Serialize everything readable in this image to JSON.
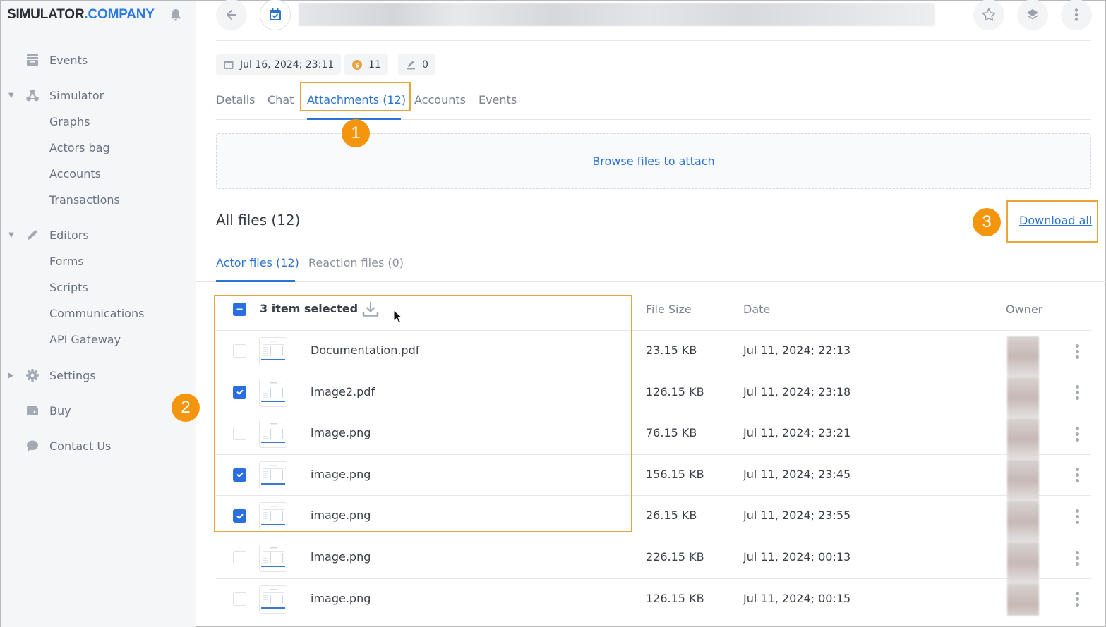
{
  "app": {
    "logo_main": "SIMULATOR",
    "logo_accent": ".COMPANY"
  },
  "sidebar": {
    "items": [
      {
        "label": "Events",
        "icon": "archive-icon"
      },
      {
        "label": "Simulator",
        "icon": "graph-nodes-icon",
        "expanded": true,
        "children": [
          "Graphs",
          "Actors bag",
          "Accounts",
          "Transactions"
        ]
      },
      {
        "label": "Editors",
        "icon": "pencil-icon",
        "expanded": true,
        "children": [
          "Forms",
          "Scripts",
          "Communications",
          "API Gateway"
        ]
      },
      {
        "label": "Settings",
        "icon": "gear-icon",
        "expanded": false
      },
      {
        "label": "Buy",
        "icon": "wallet-icon"
      },
      {
        "label": "Contact Us",
        "icon": "chat-bubble-icon"
      }
    ]
  },
  "header": {
    "title_blurred": true,
    "actions": [
      "star-icon",
      "layers-icon",
      "more-vertical-icon"
    ]
  },
  "chips": {
    "date": "Jul 16, 2024; 23:11",
    "coins": "11",
    "edits": "0"
  },
  "tabs": [
    {
      "label": "Details",
      "active": false
    },
    {
      "label": "Chat",
      "active": false
    },
    {
      "label": "Attachments (12)",
      "active": true
    },
    {
      "label": "Accounts",
      "active": false
    },
    {
      "label": "Events",
      "active": false
    }
  ],
  "dropzone": {
    "label": "Browse files to attach"
  },
  "files": {
    "title": "All files (12)",
    "download_all": "Download all",
    "subtabs": [
      {
        "label": "Actor files (12)",
        "active": true
      },
      {
        "label": "Reaction files (0)",
        "active": false
      }
    ],
    "selected_label": "3 item selected",
    "columns": {
      "size": "File Size",
      "date": "Date",
      "owner": "Owner"
    },
    "rows": [
      {
        "name": "Documentation.pdf",
        "size": "23.15 KB",
        "date": "Jul 11, 2024; 22:13",
        "checked": false
      },
      {
        "name": "image2.pdf",
        "size": "126.15 KB",
        "date": "Jul 11, 2024; 23:18",
        "checked": true
      },
      {
        "name": "image.png",
        "size": "76.15 KB",
        "date": "Jul 11, 2024; 23:21",
        "checked": false
      },
      {
        "name": "image.png",
        "size": "156.15 KB",
        "date": "Jul 11, 2024; 23:45",
        "checked": true
      },
      {
        "name": "image.png",
        "size": "26.15 KB",
        "date": "Jul 11, 2024; 23:55",
        "checked": true
      },
      {
        "name": "image.png",
        "size": "226.15 KB",
        "date": "Jul 11, 2024; 00:13",
        "checked": false
      },
      {
        "name": "image.png",
        "size": "126.15 KB",
        "date": "Jul 11, 2024; 00:15",
        "checked": false
      }
    ]
  },
  "annotations": {
    "badge_1": "1",
    "badge_2": "2",
    "badge_3": "3",
    "highlight_color": "#e9a43a",
    "badge_color": "#f4950e"
  },
  "colors": {
    "accent": "#2d73d0",
    "checkbox": "#2a6fe0"
  }
}
